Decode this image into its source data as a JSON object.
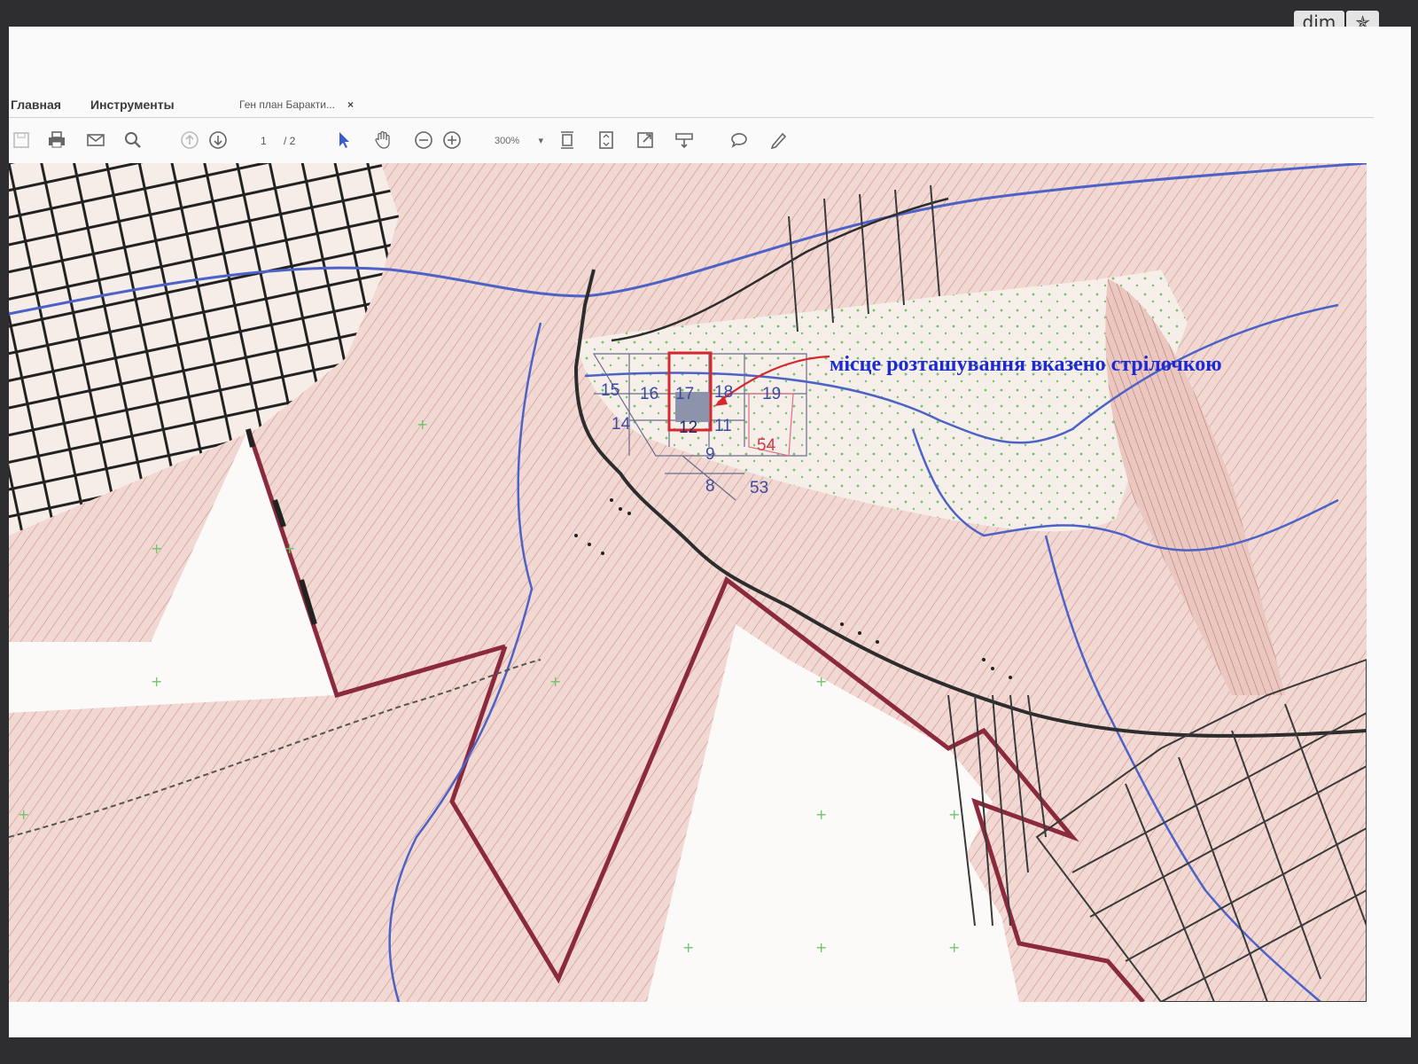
{
  "viewer_corner": {
    "btn1": "dim",
    "btn2": "✯"
  },
  "menu": {
    "home": "Главная",
    "tools": "Инструменты"
  },
  "doc_tab": {
    "title": "Ген план Баракти...",
    "close": "×"
  },
  "toolbar": {
    "page_current": "1",
    "page_total": "/ 2",
    "zoom": "300%",
    "zoom_arrow": "▾"
  },
  "map": {
    "annotation": "місце  розташування вказено стрілочкою",
    "plots": [
      "15",
      "16",
      "17",
      "18",
      "19",
      "14",
      "12",
      "11",
      "54",
      "9",
      "8",
      "53"
    ],
    "selected_plot": "12",
    "colors": {
      "contour": "#c98a80",
      "fill": "#f2d6d0",
      "boundary": "#8b2a3c",
      "river": "#4d62c7",
      "highlight": "#d8282e",
      "annotation": "#1a2ad6"
    }
  }
}
